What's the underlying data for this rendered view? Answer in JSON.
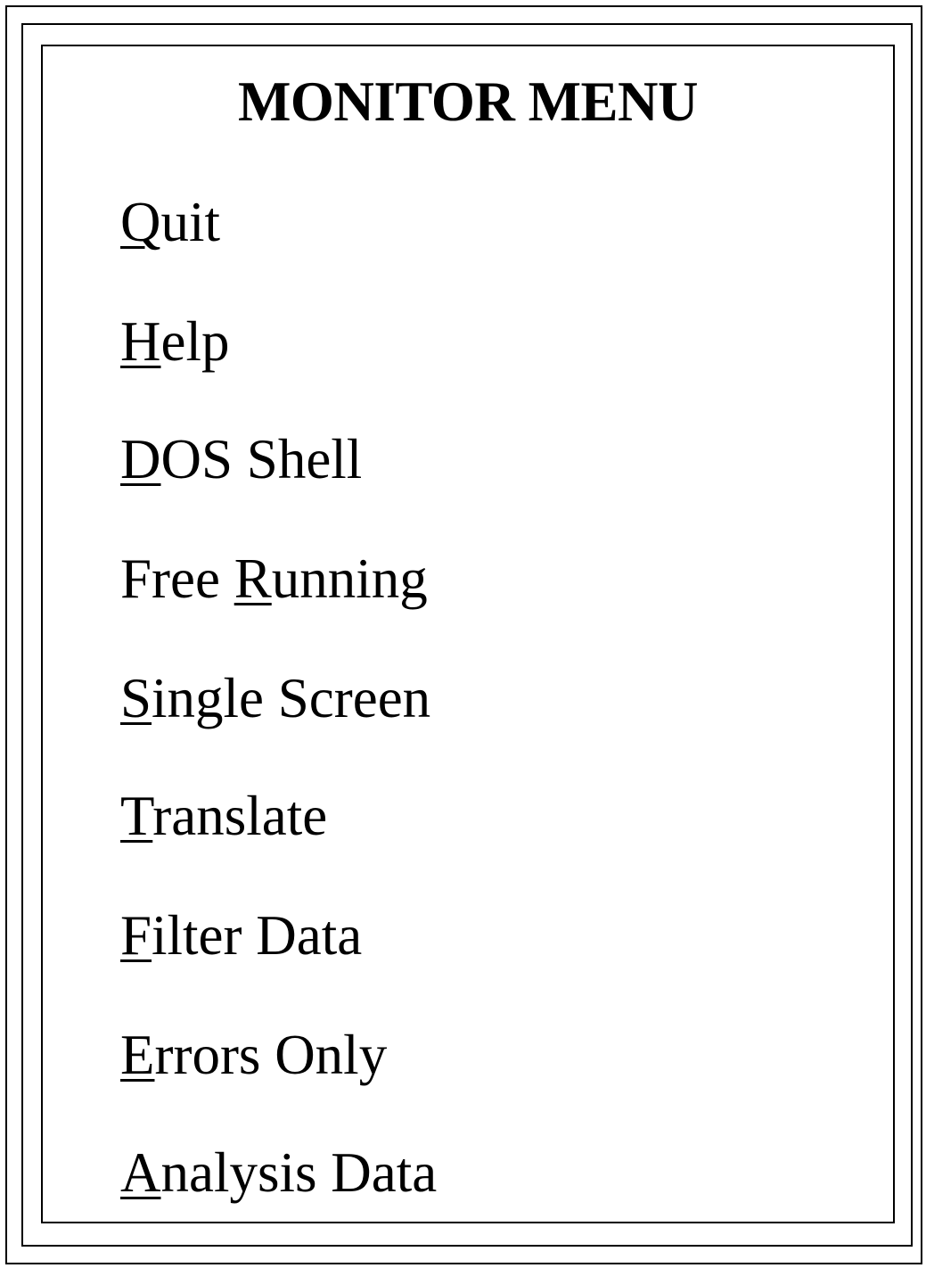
{
  "menu": {
    "title": "MONITOR MENU",
    "items": [
      {
        "pre": "",
        "key": "Q",
        "post": "uit"
      },
      {
        "pre": "",
        "key": "H",
        "post": "elp"
      },
      {
        "pre": "",
        "key": "D",
        "post": "OS Shell"
      },
      {
        "pre": "Free ",
        "key": "R",
        "post": "unning"
      },
      {
        "pre": "",
        "key": "S",
        "post": "ingle Screen"
      },
      {
        "pre": "",
        "key": "T",
        "post": "ranslate"
      },
      {
        "pre": "",
        "key": "F",
        "post": "ilter Data"
      },
      {
        "pre": "",
        "key": "E",
        "post": "rrors Only"
      },
      {
        "pre": "",
        "key": "A",
        "post": "nalysis Data"
      }
    ]
  }
}
